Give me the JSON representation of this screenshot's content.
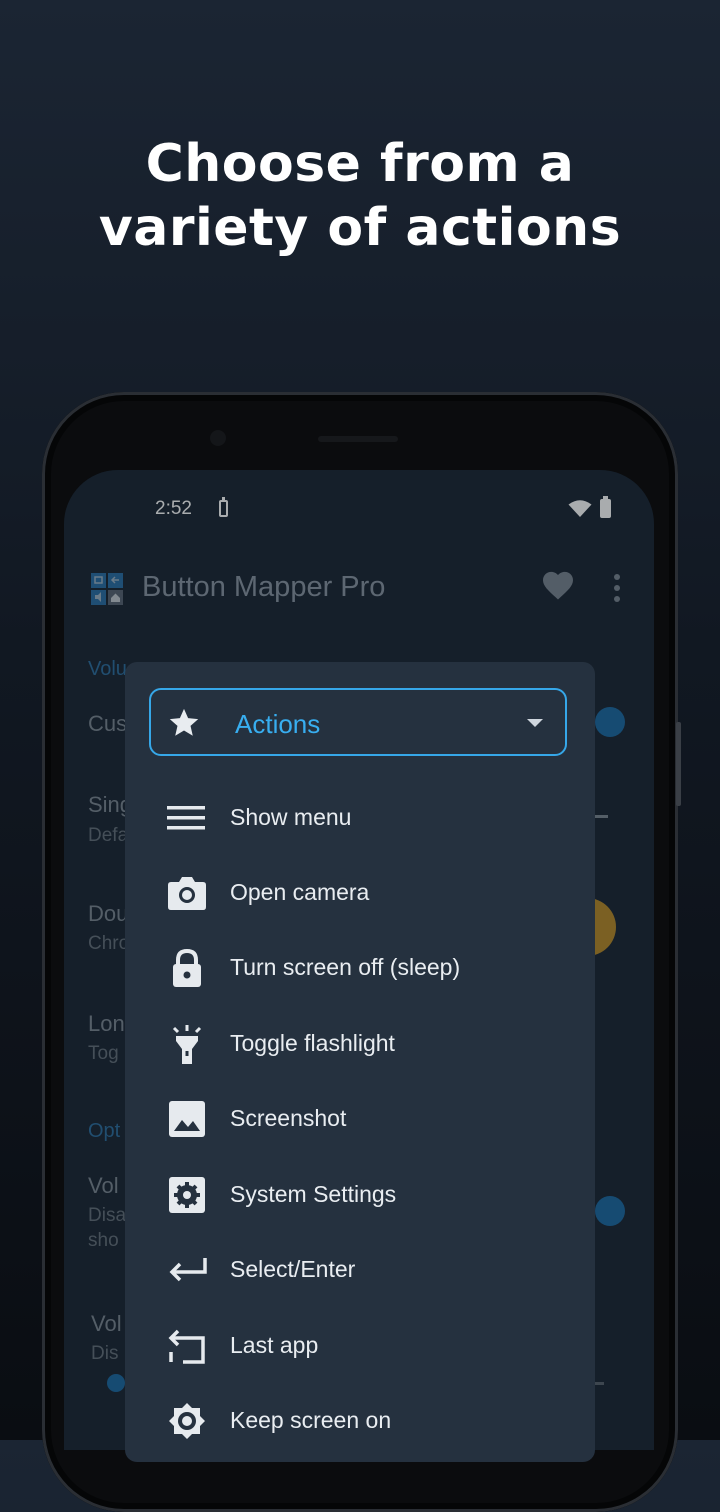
{
  "promo": {
    "line1": "Choose from a",
    "line2": "variety of actions"
  },
  "statusbar": {
    "time": "2:52"
  },
  "app": {
    "title": "Button Mapper Pro"
  },
  "background_rows": {
    "r1": "Volu",
    "r2": "Cus",
    "r3": "Sing",
    "r3sub": "Defa",
    "r4": "Dou",
    "r4sub": "Chro",
    "r5": "Lon",
    "r5sub": "Tog",
    "r6": "Opt",
    "r7": "Vol",
    "r7sub1": "Disa",
    "r7sub2": "sho",
    "r8": "Vol",
    "r8sub": "Dis"
  },
  "dialog": {
    "dropdown": {
      "selected": "Actions",
      "icon": "star-icon"
    },
    "items": [
      {
        "label": "Show menu",
        "icon": "menu-icon"
      },
      {
        "label": "Open camera",
        "icon": "camera-icon"
      },
      {
        "label": "Turn screen off (sleep)",
        "icon": "lock-icon"
      },
      {
        "label": "Toggle flashlight",
        "icon": "flashlight-icon"
      },
      {
        "label": "Screenshot",
        "icon": "image-icon"
      },
      {
        "label": "System Settings",
        "icon": "settings-icon"
      },
      {
        "label": "Select/Enter",
        "icon": "enter-icon"
      },
      {
        "label": "Last app",
        "icon": "last-app-icon"
      },
      {
        "label": "Keep screen on",
        "icon": "brightness-icon"
      }
    ]
  },
  "colors": {
    "accent": "#36a7e8",
    "dialog_bg": "#25313f",
    "screen_bg": "#1c2735"
  }
}
